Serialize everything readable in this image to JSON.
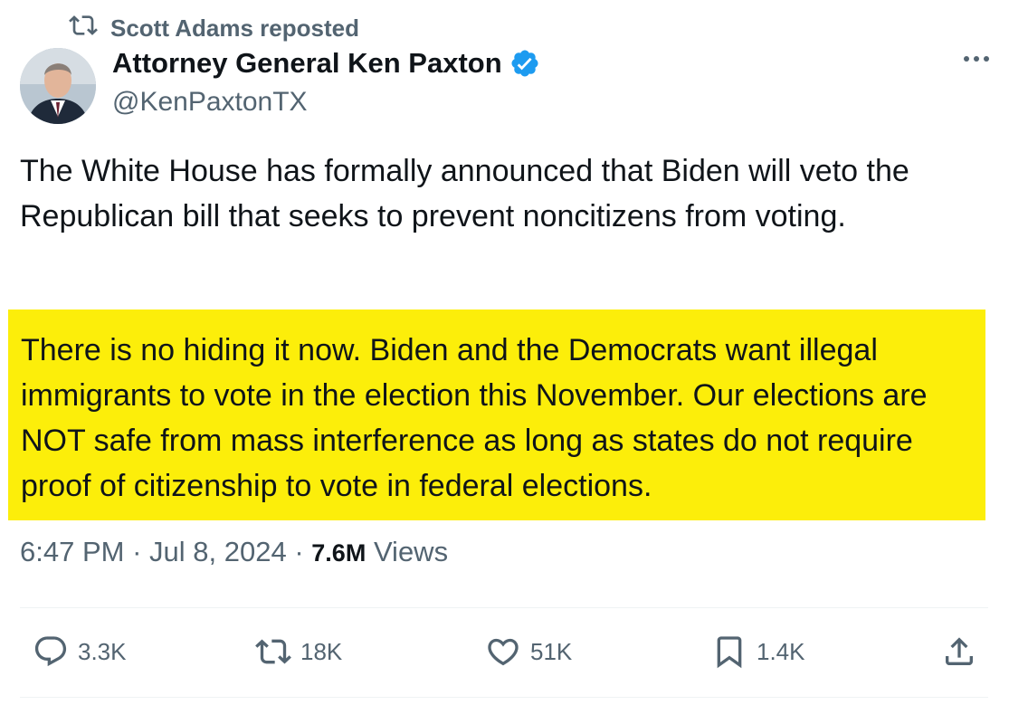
{
  "repost": {
    "label": "Scott Adams reposted",
    "icon": "repost-icon"
  },
  "author": {
    "display_name": "Attorney General Ken Paxton",
    "handle": "@KenPaxtonTX",
    "verified": true,
    "verified_color": "#1d9bf0"
  },
  "tweet": {
    "text": "The White House has formally announced that Biden will veto the Republican bill that seeks to prevent noncitizens from voting.",
    "highlighted_text": "There is no hiding it now. Biden and the Democrats want illegal immigrants to vote in the election this November. Our elections are NOT safe from mass interference as long as states do not require proof of citizenship to vote in federal elections.",
    "highlight_color": "#fcee0a"
  },
  "meta": {
    "time": "6:47 PM",
    "separator": "·",
    "date": "Jul 8, 2024",
    "views_count": "7.6M",
    "views_label": "Views"
  },
  "actions": {
    "replies": "3.3K",
    "reposts": "18K",
    "likes": "51K",
    "bookmarks": "1.4K"
  },
  "colors": {
    "text_primary": "#0f1419",
    "text_secondary": "#536471",
    "divider": "#eff3f4"
  }
}
